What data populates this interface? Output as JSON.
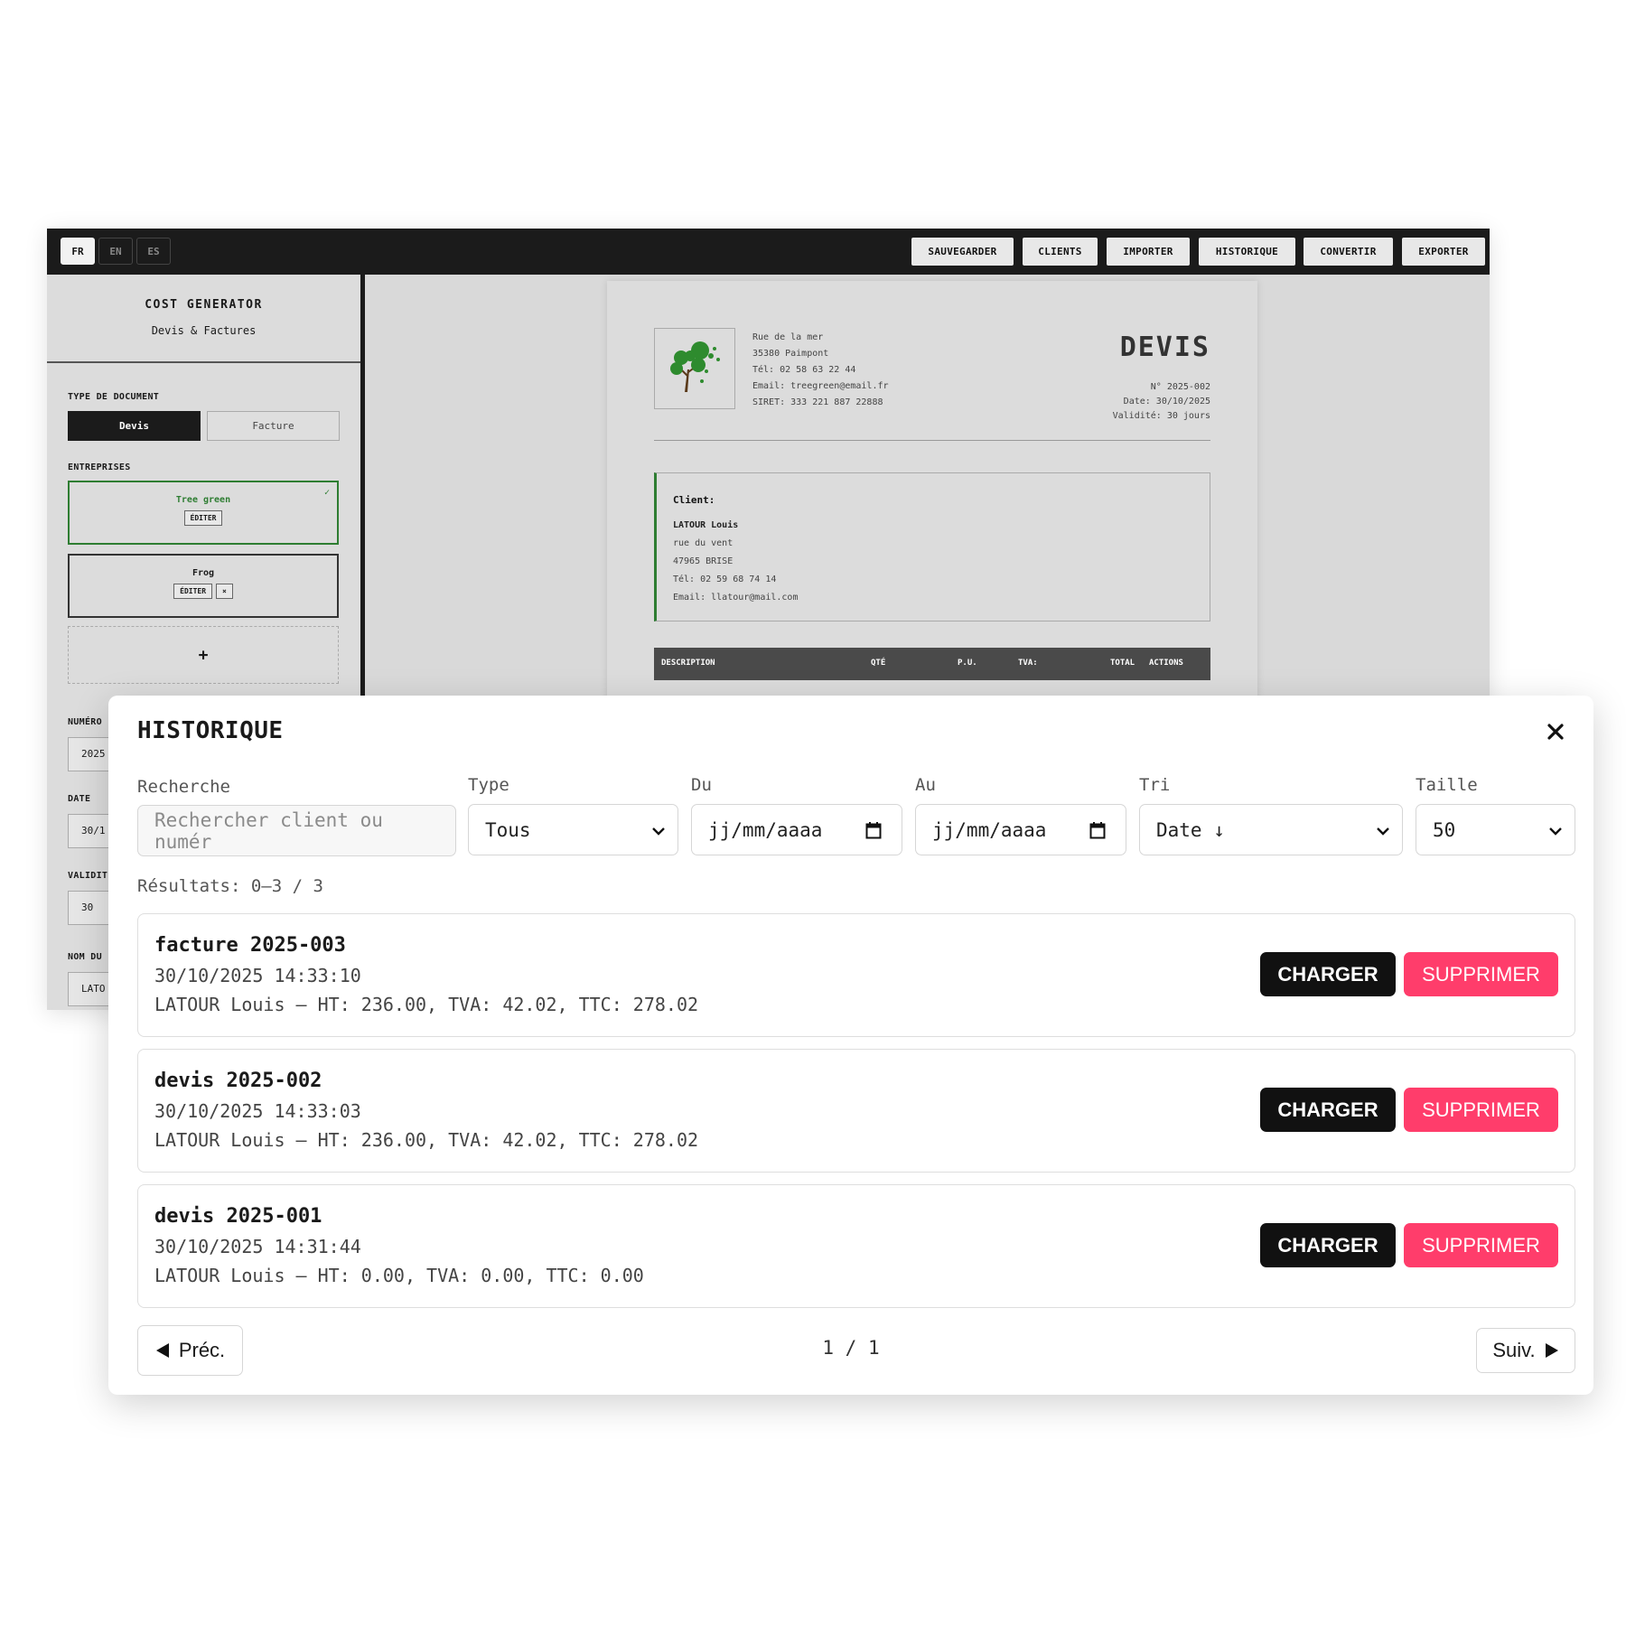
{
  "app": {
    "languages": [
      "FR",
      "EN",
      "ES"
    ],
    "toolbar": [
      "SAUVEGARDER",
      "CLIENTS",
      "IMPORTER",
      "HISTORIQUE",
      "CONVERTIR",
      "EXPORTER"
    ],
    "sidebar": {
      "title": "COST GENERATOR",
      "subtitle": "Devis & Factures",
      "doc_type_label": "TYPE DE DOCUMENT",
      "doc_types": [
        "Devis",
        "Facture"
      ],
      "companies_label": "ENTREPRISES",
      "companies": [
        {
          "name": "Tree green",
          "edit": "ÉDITER",
          "check": "✓"
        },
        {
          "name": "Frog",
          "edit": "ÉDITER",
          "remove": "×"
        }
      ],
      "add": "+",
      "number_label": "NUMÉRO",
      "number_value": "2025",
      "date_label": "DATE",
      "date_value": "30/1",
      "validity_label": "VALIDIT",
      "validity_value": "30",
      "name_label": "NOM DU",
      "name_value": "LATO"
    },
    "document": {
      "title": "DEVIS",
      "issuer_lines": [
        "Rue de la mer",
        "35380 Paimpont",
        "Tél: 02 58 63 22 44",
        "Email: treegreen@email.fr",
        "SIRET: 333 221 887 22888"
      ],
      "meta_lines": [
        "N° 2025-002",
        "Date: 30/10/2025",
        "Validité: 30 jours"
      ],
      "client_heading": "Client:",
      "client_name": "LATOUR Louis",
      "client_lines": [
        "rue du vent",
        "47965 BRISE",
        "Tél: 02 59 68 74 14",
        "Email: llatour@mail.com"
      ],
      "table_headers": [
        "DESCRIPTION",
        "QTÉ",
        "P.U.",
        "TVA:",
        "TOTAL",
        "ACTIONS"
      ]
    }
  },
  "modal": {
    "title": "HISTORIQUE",
    "filters": {
      "search_label": "Recherche",
      "search_placeholder": "Rechercher client ou numér",
      "type_label": "Type",
      "type_value": "Tous",
      "from_label": "Du",
      "from_value": "jj/mm/aaaa",
      "to_label": "Au",
      "to_value": "jj/mm/aaaa",
      "sort_label": "Tri",
      "sort_value": "Date ↓",
      "size_label": "Taille",
      "size_value": "50"
    },
    "results_text": "Résultats: 0–3 / 3",
    "items": [
      {
        "title": "facture 2025-003",
        "datetime": "30/10/2025 14:33:10",
        "summary": "LATOUR Louis — HT: 236.00, TVA: 42.02, TTC: 278.02"
      },
      {
        "title": "devis 2025-002",
        "datetime": "30/10/2025 14:33:03",
        "summary": "LATOUR Louis — HT: 236.00, TVA: 42.02, TTC: 278.02"
      },
      {
        "title": "devis 2025-001",
        "datetime": "30/10/2025 14:31:44",
        "summary": "LATOUR Louis — HT: 0.00, TVA: 0.00, TTC: 0.00"
      }
    ],
    "load_label": "CHARGER",
    "delete_label": "SUPPRIMER",
    "prev_label": "Préc.",
    "next_label": "Suiv.",
    "page_info": "1 / 1"
  },
  "colors": {
    "accent_green": "#2e7d32",
    "danger": "#ff3d6b",
    "dark": "#111111"
  }
}
